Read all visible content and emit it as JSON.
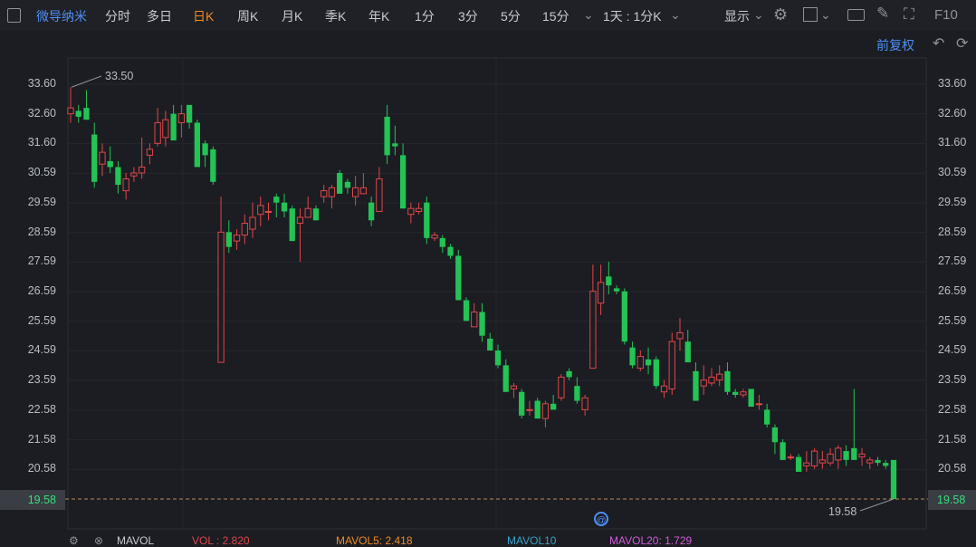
{
  "toolbar": {
    "stock_name": "微导纳米",
    "periods": [
      "分时",
      "多日",
      "日K",
      "周K",
      "月K",
      "季K",
      "年K",
      "1分",
      "3分",
      "5分",
      "15分"
    ],
    "active_period": "日K",
    "range": "1天 : 1分K",
    "display_label": "显示",
    "f10_label": "F10"
  },
  "sub": {
    "adjust_label": "前复权"
  },
  "axis": {
    "price_ticks": [
      "33.60",
      "32.60",
      "31.60",
      "30.59",
      "29.59",
      "28.59",
      "27.59",
      "26.59",
      "25.59",
      "24.59",
      "23.59",
      "22.58",
      "21.58",
      "20.58"
    ],
    "current_price": "19.58",
    "high_label": "33.50",
    "low_label": "19.58"
  },
  "volume_legend": {
    "title": "MAVOL",
    "vol": "VOL : 2.820",
    "mavol5": "MAVOL5: 2.418",
    "mavol10": "MAVOL10",
    "mavol20": "MAVOL20: 1.729"
  },
  "colors": {
    "up": "#e0464a",
    "down": "#24c356",
    "accent": "#f08a24",
    "link": "#4f8ef2"
  },
  "chart_data": {
    "type": "candlestick",
    "ylim": [
      19.58,
      33.6
    ],
    "candles": [
      {
        "o": 32.6,
        "h": 33.5,
        "l": 32.3,
        "c": 32.8
      },
      {
        "o": 32.7,
        "h": 32.9,
        "l": 32.3,
        "c": 32.5
      },
      {
        "o": 32.8,
        "h": 33.4,
        "l": 32.4,
        "c": 32.4
      },
      {
        "o": 31.9,
        "h": 32.3,
        "l": 30.1,
        "c": 30.3
      },
      {
        "o": 30.9,
        "h": 31.6,
        "l": 30.5,
        "c": 31.3
      },
      {
        "o": 31.0,
        "h": 31.5,
        "l": 30.6,
        "c": 30.8
      },
      {
        "o": 30.8,
        "h": 31.0,
        "l": 29.9,
        "c": 30.2
      },
      {
        "o": 30.0,
        "h": 30.6,
        "l": 29.7,
        "c": 30.4
      },
      {
        "o": 30.5,
        "h": 30.8,
        "l": 30.3,
        "c": 30.6
      },
      {
        "o": 30.6,
        "h": 31.8,
        "l": 30.4,
        "c": 30.8
      },
      {
        "o": 31.2,
        "h": 31.6,
        "l": 30.9,
        "c": 31.4
      },
      {
        "o": 31.6,
        "h": 32.8,
        "l": 31.5,
        "c": 32.3
      },
      {
        "o": 31.8,
        "h": 32.7,
        "l": 31.5,
        "c": 32.4
      },
      {
        "o": 32.6,
        "h": 32.9,
        "l": 31.7,
        "c": 31.7
      },
      {
        "o": 32.3,
        "h": 32.9,
        "l": 31.8,
        "c": 32.6
      },
      {
        "o": 32.9,
        "h": 32.9,
        "l": 32.1,
        "c": 32.3
      },
      {
        "o": 32.3,
        "h": 32.4,
        "l": 30.8,
        "c": 30.8
      },
      {
        "o": 31.6,
        "h": 31.7,
        "l": 30.8,
        "c": 31.2
      },
      {
        "o": 31.4,
        "h": 31.5,
        "l": 30.2,
        "c": 30.3
      },
      {
        "o": 24.2,
        "h": 29.8,
        "l": 24.2,
        "c": 28.6
      },
      {
        "o": 28.6,
        "h": 29.0,
        "l": 27.9,
        "c": 28.1
      },
      {
        "o": 28.3,
        "h": 28.7,
        "l": 28.0,
        "c": 28.5
      },
      {
        "o": 28.5,
        "h": 29.2,
        "l": 28.2,
        "c": 28.9
      },
      {
        "o": 28.7,
        "h": 29.6,
        "l": 28.4,
        "c": 29.1
      },
      {
        "o": 29.2,
        "h": 29.8,
        "l": 28.8,
        "c": 29.5
      },
      {
        "o": 29.3,
        "h": 29.6,
        "l": 29.0,
        "c": 29.3
      },
      {
        "o": 29.8,
        "h": 29.9,
        "l": 29.1,
        "c": 29.6
      },
      {
        "o": 29.6,
        "h": 29.9,
        "l": 29.1,
        "c": 29.3
      },
      {
        "o": 29.4,
        "h": 29.5,
        "l": 28.3,
        "c": 28.3
      },
      {
        "o": 28.9,
        "h": 29.4,
        "l": 27.6,
        "c": 29.1
      },
      {
        "o": 29.1,
        "h": 29.8,
        "l": 29.1,
        "c": 29.4
      },
      {
        "o": 29.4,
        "h": 29.5,
        "l": 29.0,
        "c": 29.0
      },
      {
        "o": 29.8,
        "h": 30.2,
        "l": 29.6,
        "c": 30.0
      },
      {
        "o": 29.8,
        "h": 30.2,
        "l": 29.4,
        "c": 30.1
      },
      {
        "o": 30.6,
        "h": 30.7,
        "l": 29.9,
        "c": 29.9
      },
      {
        "o": 30.3,
        "h": 30.4,
        "l": 29.9,
        "c": 30.1
      },
      {
        "o": 29.8,
        "h": 30.5,
        "l": 29.5,
        "c": 30.1
      },
      {
        "o": 29.9,
        "h": 30.6,
        "l": 29.9,
        "c": 30.1
      },
      {
        "o": 29.6,
        "h": 29.8,
        "l": 28.8,
        "c": 29.0
      },
      {
        "o": 29.3,
        "h": 30.8,
        "l": 29.3,
        "c": 30.4
      },
      {
        "o": 32.5,
        "h": 32.9,
        "l": 30.9,
        "c": 31.2
      },
      {
        "o": 31.6,
        "h": 32.2,
        "l": 31.2,
        "c": 31.5
      },
      {
        "o": 31.2,
        "h": 31.6,
        "l": 29.4,
        "c": 29.4
      },
      {
        "o": 29.2,
        "h": 29.6,
        "l": 28.9,
        "c": 29.4
      },
      {
        "o": 29.3,
        "h": 29.6,
        "l": 29.2,
        "c": 29.4
      },
      {
        "o": 29.6,
        "h": 29.8,
        "l": 28.2,
        "c": 28.4
      },
      {
        "o": 28.4,
        "h": 28.6,
        "l": 28.3,
        "c": 28.5
      },
      {
        "o": 28.4,
        "h": 28.5,
        "l": 27.9,
        "c": 28.1
      },
      {
        "o": 28.1,
        "h": 28.2,
        "l": 27.7,
        "c": 27.8
      },
      {
        "o": 27.8,
        "h": 28.0,
        "l": 26.3,
        "c": 26.3
      },
      {
        "o": 26.3,
        "h": 26.4,
        "l": 25.6,
        "c": 25.6
      },
      {
        "o": 25.4,
        "h": 26.2,
        "l": 25.4,
        "c": 25.9
      },
      {
        "o": 25.9,
        "h": 26.2,
        "l": 24.9,
        "c": 25.1
      },
      {
        "o": 25.0,
        "h": 25.2,
        "l": 24.6,
        "c": 24.6
      },
      {
        "o": 24.6,
        "h": 24.8,
        "l": 24.0,
        "c": 24.1
      },
      {
        "o": 24.1,
        "h": 24.3,
        "l": 23.2,
        "c": 23.2
      },
      {
        "o": 23.3,
        "h": 23.5,
        "l": 23.0,
        "c": 23.4
      },
      {
        "o": 23.2,
        "h": 23.3,
        "l": 22.3,
        "c": 22.4
      },
      {
        "o": 22.6,
        "h": 22.9,
        "l": 22.4,
        "c": 22.6
      },
      {
        "o": 22.9,
        "h": 23.0,
        "l": 22.3,
        "c": 22.3
      },
      {
        "o": 22.3,
        "h": 22.9,
        "l": 22.0,
        "c": 22.8
      },
      {
        "o": 22.8,
        "h": 23.1,
        "l": 22.6,
        "c": 22.6
      },
      {
        "o": 23.0,
        "h": 23.8,
        "l": 22.9,
        "c": 23.7
      },
      {
        "o": 23.9,
        "h": 24.0,
        "l": 23.6,
        "c": 23.7
      },
      {
        "o": 23.4,
        "h": 23.7,
        "l": 22.8,
        "c": 22.9
      },
      {
        "o": 22.6,
        "h": 23.1,
        "l": 22.4,
        "c": 23.0
      },
      {
        "o": 24.0,
        "h": 27.5,
        "l": 24.0,
        "c": 26.6
      },
      {
        "o": 26.2,
        "h": 27.5,
        "l": 25.8,
        "c": 26.9
      },
      {
        "o": 27.1,
        "h": 27.6,
        "l": 26.5,
        "c": 26.8
      },
      {
        "o": 26.7,
        "h": 26.8,
        "l": 26.5,
        "c": 26.6
      },
      {
        "o": 26.6,
        "h": 26.7,
        "l": 24.8,
        "c": 24.9
      },
      {
        "o": 24.7,
        "h": 24.9,
        "l": 24.0,
        "c": 24.1
      },
      {
        "o": 24.0,
        "h": 24.6,
        "l": 23.9,
        "c": 24.4
      },
      {
        "o": 24.3,
        "h": 24.7,
        "l": 23.8,
        "c": 24.1
      },
      {
        "o": 24.3,
        "h": 24.4,
        "l": 23.3,
        "c": 23.4
      },
      {
        "o": 23.2,
        "h": 23.6,
        "l": 23.0,
        "c": 23.4
      },
      {
        "o": 23.3,
        "h": 25.2,
        "l": 23.1,
        "c": 24.9
      },
      {
        "o": 25.0,
        "h": 25.7,
        "l": 24.6,
        "c": 25.2
      },
      {
        "o": 24.9,
        "h": 25.3,
        "l": 24.3,
        "c": 24.2
      },
      {
        "o": 23.9,
        "h": 24.2,
        "l": 22.9,
        "c": 22.9
      },
      {
        "o": 23.4,
        "h": 24.1,
        "l": 23.1,
        "c": 23.6
      },
      {
        "o": 23.5,
        "h": 24.0,
        "l": 23.4,
        "c": 23.7
      },
      {
        "o": 23.6,
        "h": 24.1,
        "l": 23.4,
        "c": 23.8
      },
      {
        "o": 23.9,
        "h": 24.2,
        "l": 23.1,
        "c": 23.2
      },
      {
        "o": 23.2,
        "h": 23.3,
        "l": 23.0,
        "c": 23.1
      },
      {
        "o": 23.1,
        "h": 23.3,
        "l": 23.0,
        "c": 23.2
      },
      {
        "o": 23.3,
        "h": 23.3,
        "l": 22.7,
        "c": 22.7
      },
      {
        "o": 22.8,
        "h": 23.1,
        "l": 22.6,
        "c": 22.8
      },
      {
        "o": 22.6,
        "h": 22.8,
        "l": 22.0,
        "c": 22.1
      },
      {
        "o": 22.0,
        "h": 22.1,
        "l": 21.1,
        "c": 21.5
      },
      {
        "o": 21.5,
        "h": 21.6,
        "l": 20.9,
        "c": 20.9
      },
      {
        "o": 21.0,
        "h": 21.1,
        "l": 20.9,
        "c": 21.0
      },
      {
        "o": 21.0,
        "h": 21.1,
        "l": 20.5,
        "c": 20.5
      },
      {
        "o": 20.7,
        "h": 21.2,
        "l": 20.5,
        "c": 20.8
      },
      {
        "o": 20.7,
        "h": 21.3,
        "l": 20.6,
        "c": 21.2
      },
      {
        "o": 20.8,
        "h": 21.2,
        "l": 20.6,
        "c": 20.9
      },
      {
        "o": 20.8,
        "h": 21.3,
        "l": 20.7,
        "c": 21.1
      },
      {
        "o": 20.9,
        "h": 21.4,
        "l": 20.6,
        "c": 21.3
      },
      {
        "o": 21.2,
        "h": 21.4,
        "l": 20.7,
        "c": 20.9
      },
      {
        "o": 21.3,
        "h": 23.3,
        "l": 21.0,
        "c": 20.9
      },
      {
        "o": 21.0,
        "h": 21.3,
        "l": 20.7,
        "c": 21.1
      },
      {
        "o": 20.8,
        "h": 21.0,
        "l": 20.6,
        "c": 20.9
      },
      {
        "o": 20.9,
        "h": 21.0,
        "l": 20.7,
        "c": 20.8
      },
      {
        "o": 20.8,
        "h": 20.9,
        "l": 20.6,
        "c": 20.7
      },
      {
        "o": 20.9,
        "h": 20.9,
        "l": 19.58,
        "c": 19.58
      }
    ]
  }
}
